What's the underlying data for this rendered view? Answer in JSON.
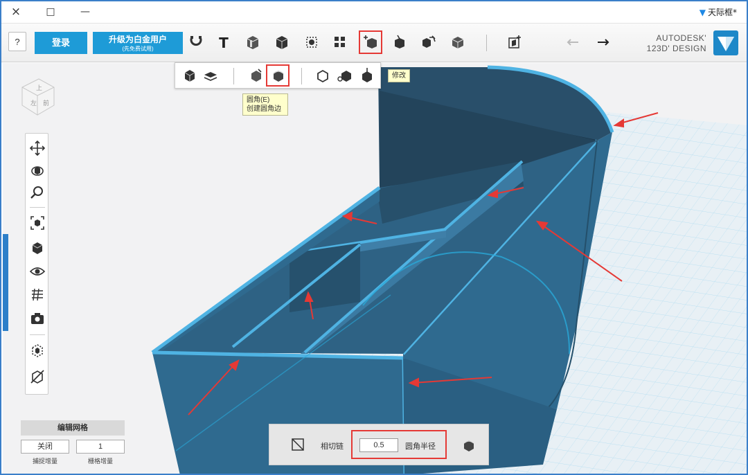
{
  "window": {
    "close_icon": "×",
    "maximize_icon": "□",
    "minimize_icon": "—",
    "title": "天际框*"
  },
  "toolbar": {
    "help_label": "?",
    "login_label": "登录",
    "upgrade_line1": "升级为白金用户",
    "upgrade_line2": "(先免费试用)",
    "selected_tool": "modify-tool"
  },
  "brand": {
    "line1": "AUTODESK'",
    "line2": "123D' DESIGN"
  },
  "modify_submenu": {
    "tooltip_top": "修改",
    "fillet_tooltip_line1": "圆角(E)",
    "fillet_tooltip_line2": "创建圆角边",
    "selected_item": "fillet"
  },
  "snap_grid": {
    "title": "编辑网格",
    "snap_value": "关闭",
    "grid_value": "1",
    "snap_label": "捕捉增量",
    "grid_label": "栅格增量"
  },
  "fillet_panel": {
    "radius_label": "圆角半径",
    "radius_value": "0.5",
    "tangent_label": "相切链"
  },
  "colors": {
    "accent": "#1e9bd7",
    "model_fill": "#2f6a8f",
    "model_edge": "#4fb3e3",
    "grid_line": "#9cd2ec",
    "highlight_box": "#e53935",
    "arrow": "#e53935"
  }
}
